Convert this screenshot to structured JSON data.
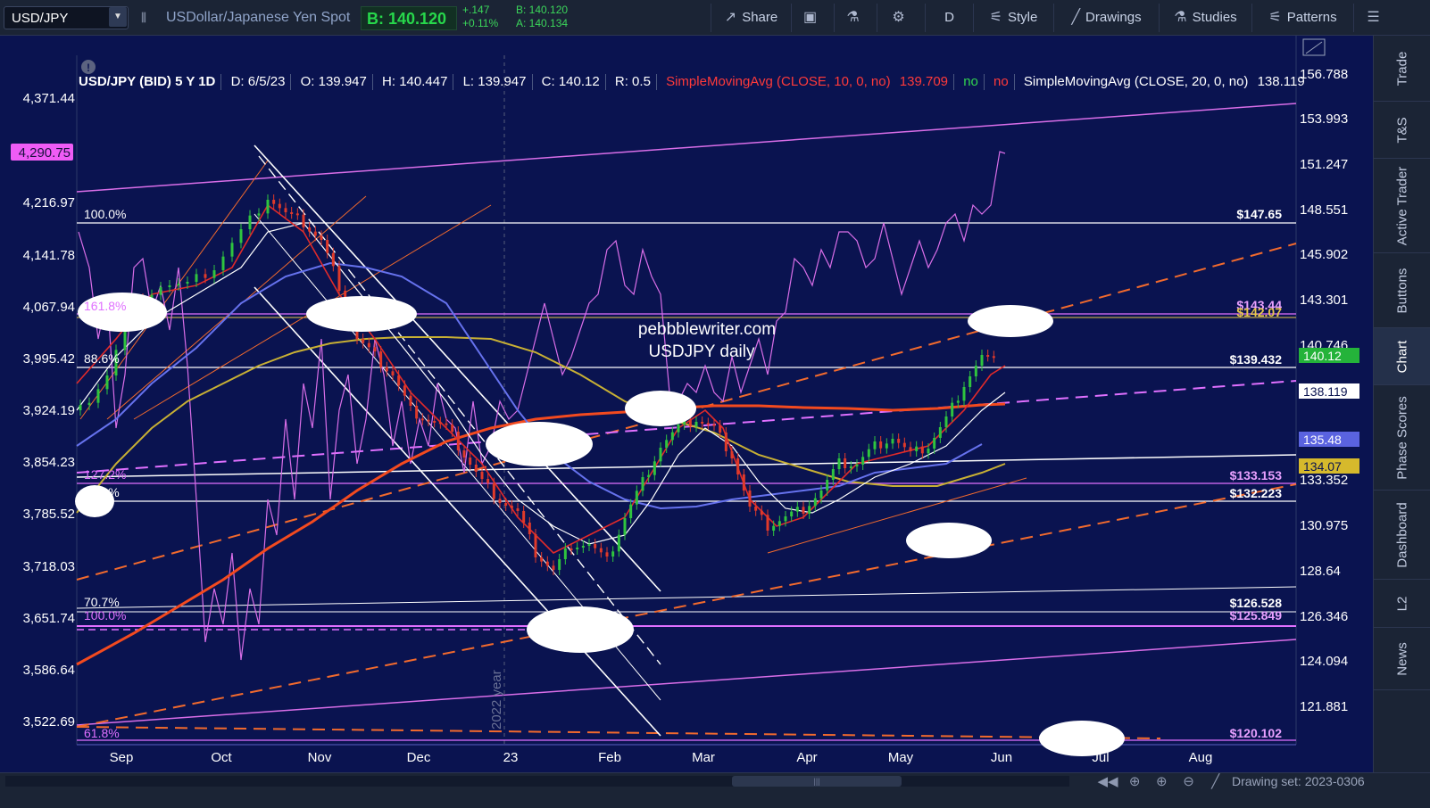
{
  "toolbar": {
    "symbol": "USD/JPY",
    "description": "USDollar/Japanese Yen Spot",
    "bid_price": "B: 140.120",
    "change_abs": "+.147",
    "change_pct": "+0.11%",
    "bid_label": "B: 140.120",
    "ask_label": "A: 140.134",
    "share": "Share",
    "period": "D",
    "style": "Style",
    "drawings": "Drawings",
    "studies": "Studies",
    "patterns": "Patterns",
    "icons": [
      "link-icon",
      "share-icon",
      "screenshot-icon",
      "flask-icon",
      "gear-icon",
      "style-icon",
      "pencil-icon",
      "flask-icon",
      "patterns-icon",
      "menu-icon"
    ]
  },
  "infobar": {
    "symbol_period": "USD/JPY (BID) 5 Y 1D",
    "date": "D: 6/5/23",
    "open": "O: 139.947",
    "high": "H: 140.447",
    "low": "L: 139.947",
    "close": "C: 140.12",
    "range": "R: 0.5",
    "sma10": "SimpleMovingAvg (CLOSE, 10, 0, no)",
    "sma10_value": "139.709",
    "flag_no1": "no",
    "flag_no2": "no",
    "sma20": "SimpleMovingAvg (CLOSE, 20, 0, no)",
    "sma20_value": "138.119"
  },
  "chart": {
    "watermark_line1": "pebbblewriter.com",
    "watermark_line2": "USDJPY daily",
    "year_marker": "2022 year",
    "left_axis": [
      "4,371.44",
      "4,216.97",
      "4,141.78",
      "4,067.94",
      "3,995.42",
      "3,924.19",
      "3,854.23",
      "3,785.52",
      "3,718.03",
      "3,651.74",
      "3,586.64",
      "3,522.69"
    ],
    "left_axis_highlight": "4,290.75",
    "right_axis": [
      "156.788",
      "153.993",
      "151.247",
      "148.551",
      "145.902",
      "143.301",
      "140.746",
      "133.352",
      "130.975",
      "128.64",
      "126.346",
      "124.094",
      "121.881"
    ],
    "right_badges": {
      "last": "140.12",
      "sma20": "138.119",
      "blue": "135.48",
      "gold": "134.07"
    },
    "x_labels": [
      "Sep",
      "Oct",
      "Nov",
      "Dec",
      "23",
      "Feb",
      "Mar",
      "Apr",
      "May",
      "Jun",
      "Jul",
      "Aug"
    ],
    "fib_left": [
      "100.0%",
      "161.8%",
      "88.6%",
      "127.2%",
      "78.6%",
      "70.7%",
      "100.0%",
      "61.8%"
    ],
    "price_labels_right": [
      "$147.65",
      "$143.44",
      "$142.07",
      "$139.432",
      "$133.153",
      "$132.223",
      "$126.528",
      "$125.849",
      "$120.102"
    ]
  },
  "side_tabs": [
    "Trade",
    "T&S",
    "Active Trader",
    "Buttons",
    "Chart",
    "Phase Scores",
    "Dashboard",
    "L2",
    "News"
  ],
  "bottom": {
    "drawing_set": "Drawing set: 2023-0306",
    "icons": [
      "scroll-left-icon",
      "crosshair-icon",
      "zoom-in-icon",
      "zoom-out-icon",
      "pencil-icon"
    ]
  }
}
